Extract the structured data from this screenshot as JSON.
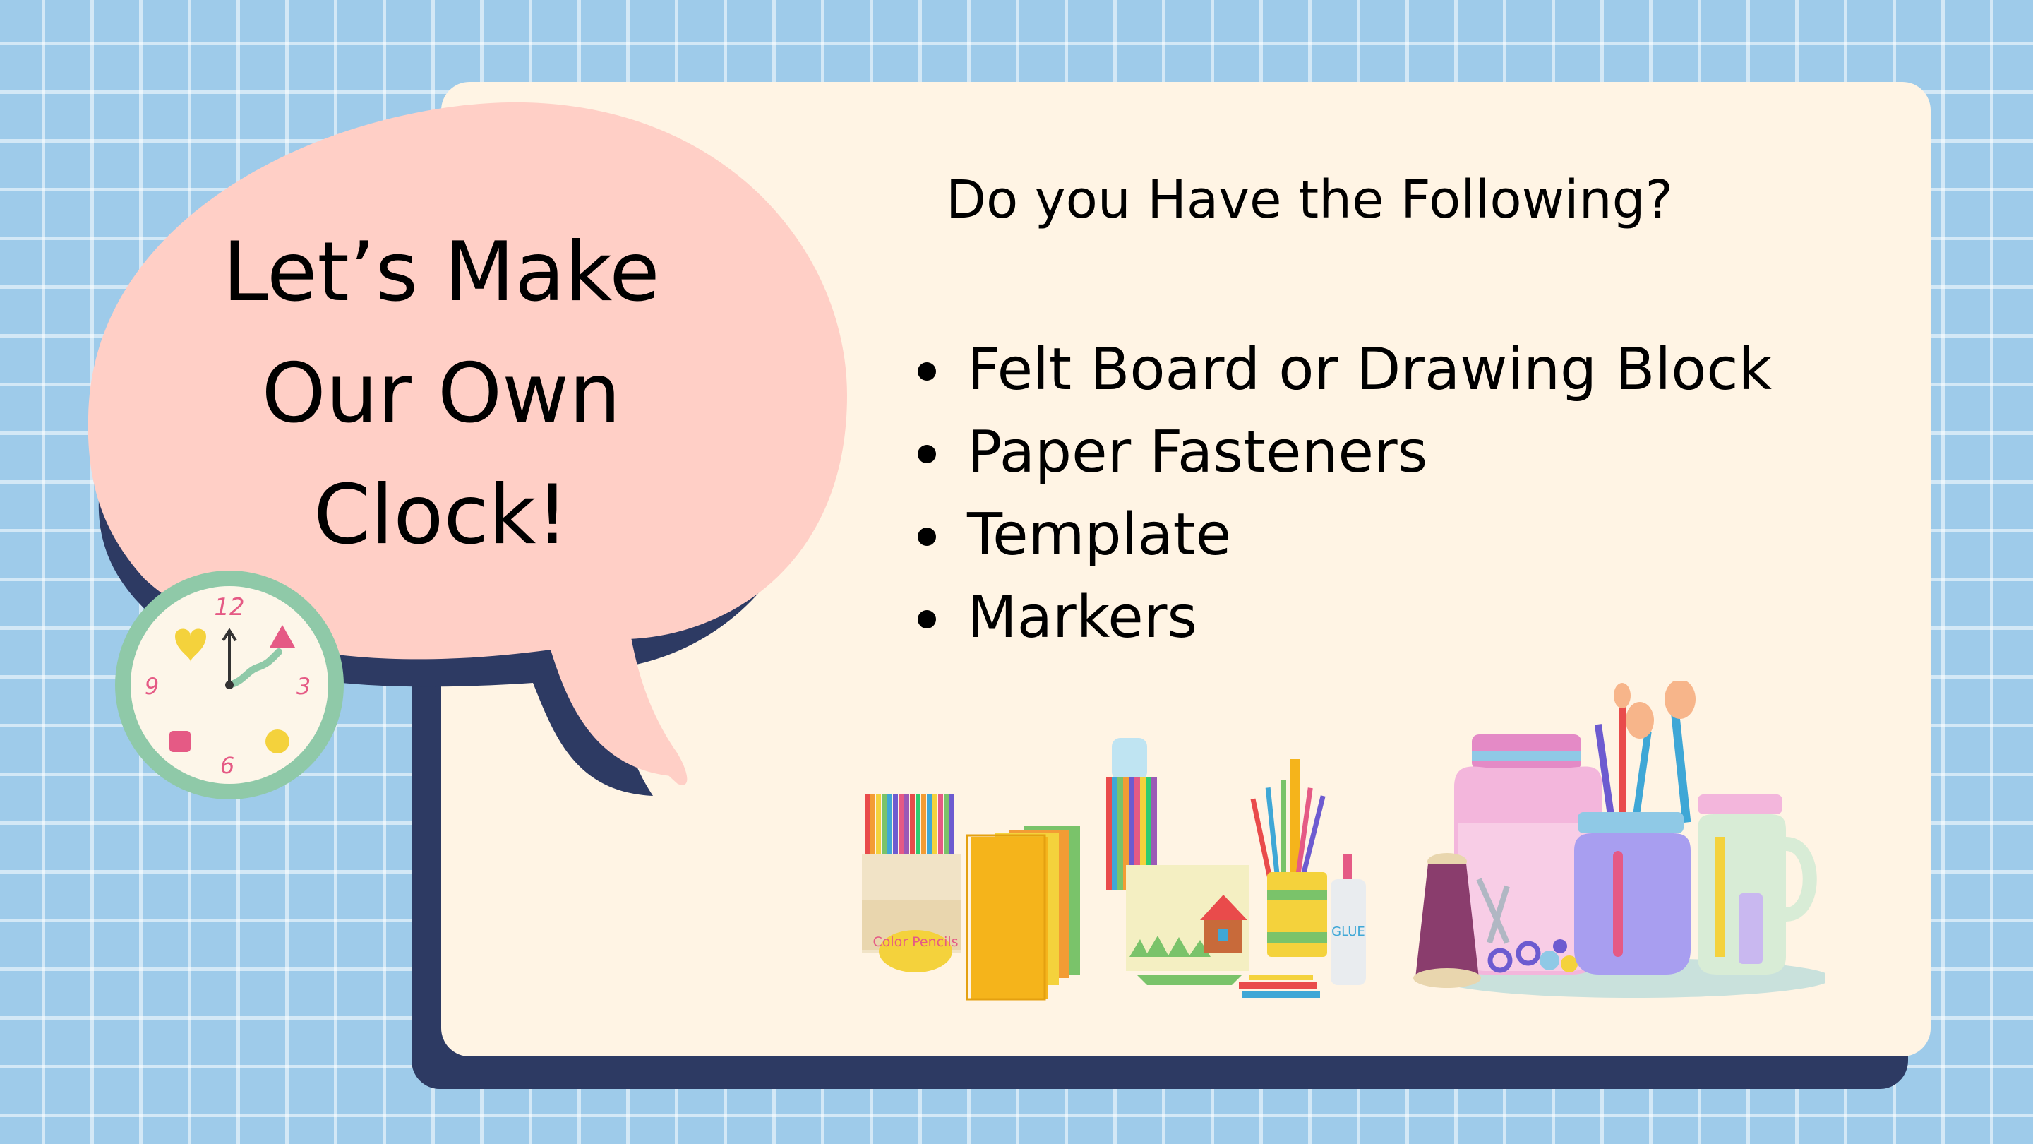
{
  "title_lines": [
    "Let’s Make",
    "Our Own",
    "Clock!"
  ],
  "question": "Do you Have the Following?",
  "supplies": [
    "Felt Board or Drawing Block",
    "Paper Fasteners",
    "Template",
    "Markers"
  ],
  "clock": {
    "labels": {
      "twelve": "12",
      "three": "3",
      "six": "6",
      "nine": "9"
    }
  },
  "art_labels": {
    "pencils": "Color Pencils",
    "glue": "GLUE"
  },
  "colors": {
    "background": "#9ecbea",
    "card": "#fff4e4",
    "shadow": "#2d3a63",
    "bubble": "#ffcfc6"
  }
}
